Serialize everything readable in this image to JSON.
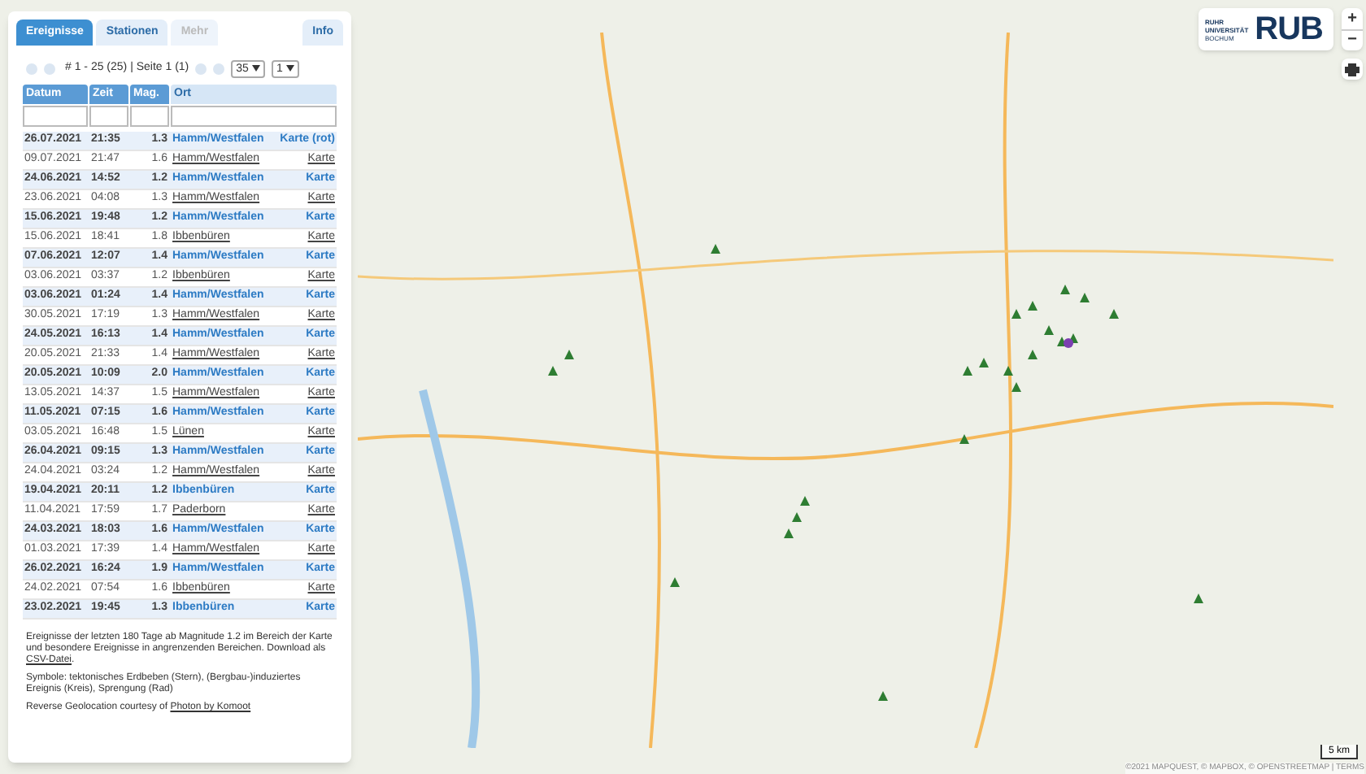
{
  "tabs": [
    {
      "label": "Ereignisse",
      "selected": true,
      "disabled": false
    },
    {
      "label": "Stationen",
      "selected": false,
      "disabled": false
    },
    {
      "label": "Mehr",
      "selected": false,
      "disabled": true
    },
    {
      "label": "Info",
      "selected": false,
      "disabled": false
    }
  ],
  "pager": {
    "summary": "# 1 - 25 (25) | Seite 1 (1)",
    "page_size": "35",
    "page": "1"
  },
  "table": {
    "columns": [
      "Datum",
      "Zeit",
      "Mag.",
      "Ort"
    ],
    "rows": [
      {
        "date": "26.07.2021",
        "time": "21:35",
        "mag": "1.3",
        "place": "Hamm/Westfalen",
        "map": "Karte (rot)",
        "highlighted": true
      },
      {
        "date": "09.07.2021",
        "time": "21:47",
        "mag": "1.6",
        "place": "Hamm/Westfalen",
        "map": "Karte",
        "highlighted": false
      },
      {
        "date": "24.06.2021",
        "time": "14:52",
        "mag": "1.2",
        "place": "Hamm/Westfalen",
        "map": "Karte",
        "highlighted": true
      },
      {
        "date": "23.06.2021",
        "time": "04:08",
        "mag": "1.3",
        "place": "Hamm/Westfalen",
        "map": "Karte",
        "highlighted": false
      },
      {
        "date": "15.06.2021",
        "time": "19:48",
        "mag": "1.2",
        "place": "Hamm/Westfalen",
        "map": "Karte",
        "highlighted": true
      },
      {
        "date": "15.06.2021",
        "time": "18:41",
        "mag": "1.8",
        "place": "Ibbenbüren",
        "map": "Karte",
        "highlighted": false
      },
      {
        "date": "07.06.2021",
        "time": "12:07",
        "mag": "1.4",
        "place": "Hamm/Westfalen",
        "map": "Karte",
        "highlighted": true
      },
      {
        "date": "03.06.2021",
        "time": "03:37",
        "mag": "1.2",
        "place": "Ibbenbüren",
        "map": "Karte",
        "highlighted": false
      },
      {
        "date": "03.06.2021",
        "time": "01:24",
        "mag": "1.4",
        "place": "Hamm/Westfalen",
        "map": "Karte",
        "highlighted": true
      },
      {
        "date": "30.05.2021",
        "time": "17:19",
        "mag": "1.3",
        "place": "Hamm/Westfalen",
        "map": "Karte",
        "highlighted": false
      },
      {
        "date": "24.05.2021",
        "time": "16:13",
        "mag": "1.4",
        "place": "Hamm/Westfalen",
        "map": "Karte",
        "highlighted": true
      },
      {
        "date": "20.05.2021",
        "time": "21:33",
        "mag": "1.4",
        "place": "Hamm/Westfalen",
        "map": "Karte",
        "highlighted": false
      },
      {
        "date": "20.05.2021",
        "time": "10:09",
        "mag": "2.0",
        "place": "Hamm/Westfalen",
        "map": "Karte",
        "highlighted": true
      },
      {
        "date": "13.05.2021",
        "time": "14:37",
        "mag": "1.5",
        "place": "Hamm/Westfalen",
        "map": "Karte",
        "highlighted": false
      },
      {
        "date": "11.05.2021",
        "time": "07:15",
        "mag": "1.6",
        "place": "Hamm/Westfalen",
        "map": "Karte",
        "highlighted": true
      },
      {
        "date": "03.05.2021",
        "time": "16:48",
        "mag": "1.5",
        "place": "Lünen",
        "map": "Karte",
        "highlighted": false
      },
      {
        "date": "26.04.2021",
        "time": "09:15",
        "mag": "1.3",
        "place": "Hamm/Westfalen",
        "map": "Karte",
        "highlighted": true
      },
      {
        "date": "24.04.2021",
        "time": "03:24",
        "mag": "1.2",
        "place": "Hamm/Westfalen",
        "map": "Karte",
        "highlighted": false
      },
      {
        "date": "19.04.2021",
        "time": "20:11",
        "mag": "1.2",
        "place": "Ibbenbüren",
        "map": "Karte",
        "highlighted": true
      },
      {
        "date": "11.04.2021",
        "time": "17:59",
        "mag": "1.7",
        "place": "Paderborn",
        "map": "Karte",
        "highlighted": false
      },
      {
        "date": "24.03.2021",
        "time": "18:03",
        "mag": "1.6",
        "place": "Hamm/Westfalen",
        "map": "Karte",
        "highlighted": true
      },
      {
        "date": "01.03.2021",
        "time": "17:39",
        "mag": "1.4",
        "place": "Hamm/Westfalen",
        "map": "Karte",
        "highlighted": false
      },
      {
        "date": "26.02.2021",
        "time": "16:24",
        "mag": "1.9",
        "place": "Hamm/Westfalen",
        "map": "Karte",
        "highlighted": true
      },
      {
        "date": "24.02.2021",
        "time": "07:54",
        "mag": "1.6",
        "place": "Ibbenbüren",
        "map": "Karte",
        "highlighted": false
      },
      {
        "date": "23.02.2021",
        "time": "19:45",
        "mag": "1.3",
        "place": "Ibbenbüren",
        "map": "Karte",
        "highlighted": true
      }
    ]
  },
  "notes": [
    {
      "text": "Ereignisse der letzten 180 Tage ab Magnitude 1.2 im Bereich der Karte und besondere Ereignisse in angrenzenden Bereichen. Download als",
      "link": "CSV-Datei",
      "after": "."
    },
    {
      "text": "Symbole: tektonisches Erdbeben (Stern), (Bergbau-)induziertes Ereignis (Kreis), Sprengung (Rad)"
    },
    {
      "text": "Reverse Geolocation courtesy of",
      "link": "Photon by Komoot"
    }
  ],
  "logo": {
    "line1": "RUHR",
    "line2": "UNIVERSITÄT",
    "line3": "BOCHUM",
    "mark": "RUB"
  },
  "zoom_controls": [
    "+",
    "−"
  ],
  "scale": "5 km",
  "attribution": "©2021 MAPQUEST, © MAPBOX, © OPENSTREETMAP | TERMS"
}
